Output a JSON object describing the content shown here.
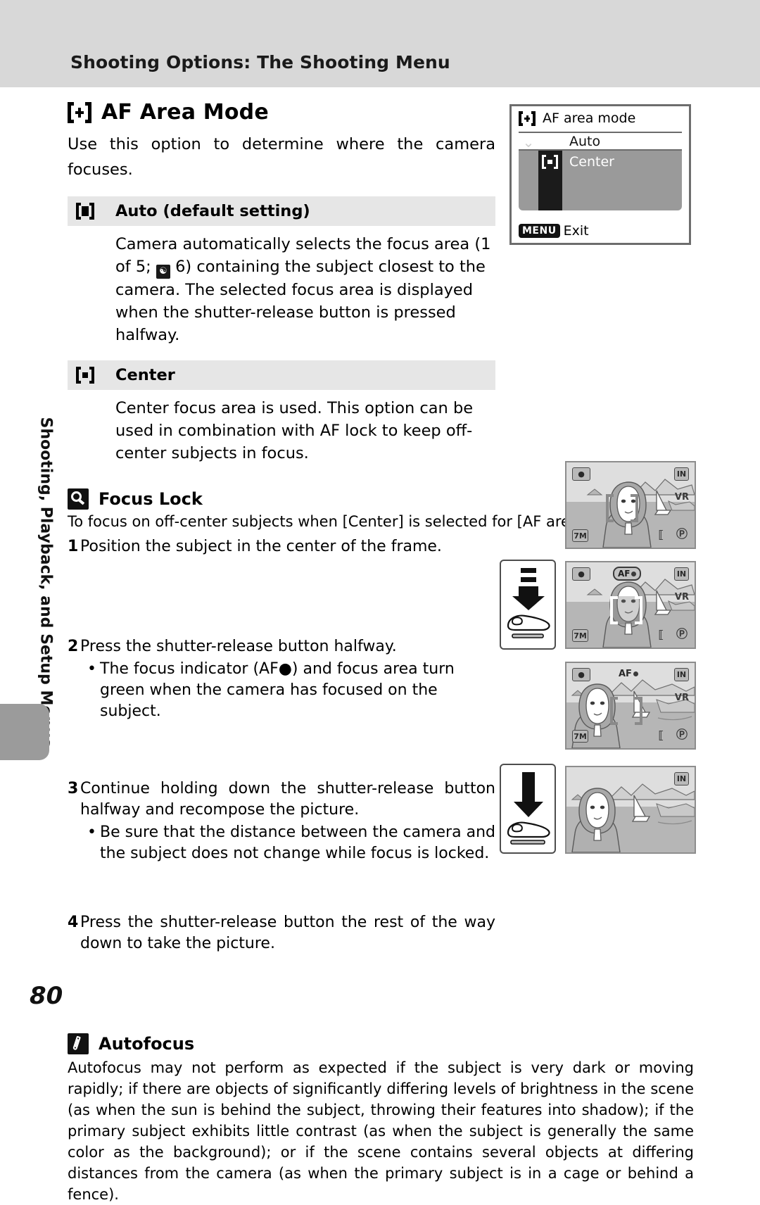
{
  "header": {
    "title": "Shooting Options: The Shooting Menu"
  },
  "side_tab": {
    "label": "Shooting, Playback, and Setup Menus"
  },
  "page_number": "80",
  "section": {
    "icon": "af-area-bracket-plus-icon",
    "title": "AF Area Mode",
    "intro": "Use this option to determine where the camera focuses."
  },
  "options": [
    {
      "icon": "bracket-filled-square-icon",
      "label": "Auto (default setting)",
      "body_before": "Camera automatically selects the focus area (1 of 5;",
      "body_glyph": "6",
      "body_after": ") containing the subject closest to the camera. The selected focus area is displayed when the shutter-release button is pressed halfway."
    },
    {
      "icon": "bracket-small-square-icon",
      "label": "Center",
      "body": "Center focus area is used. This option can be used in combination with AF lock to keep off-center subjects in focus."
    }
  ],
  "focus_lock": {
    "icon": "lightbulb-tip-icon",
    "title": "Focus Lock",
    "intro": "To focus on off-center subjects when [Center] is selected for [AF area mode]:",
    "steps": [
      {
        "num": "1",
        "text": "Position the subject in the center of the frame.",
        "bullets": []
      },
      {
        "num": "2",
        "text": "Press the shutter-release button halfway.",
        "bullets": [
          "The focus indicator (AF●) and focus area turn green when the camera has focused on the subject."
        ]
      },
      {
        "num": "3",
        "text": "Continue holding down the shutter-release button halfway and recompose the picture.",
        "bullets": [
          "Be sure that the distance between the camera and the subject does not change while focus is locked."
        ]
      },
      {
        "num": "4",
        "text": "Press the shutter-release button the rest of the way down to take the picture.",
        "bullets": []
      }
    ]
  },
  "autofocus": {
    "icon": "pencil-note-icon",
    "title": "Autofocus",
    "body": "Autofocus may not perform as expected if the subject is very dark or moving rapidly; if there are objects of significantly differing levels of brightness in the scene (as when the sun is behind the subject, throwing their features into shadow); if the primary subject exhibits little contrast (as when the subject is generally the same color as the background); or if the scene contains several objects at differing distances from the camera (as when the primary subject is in a cage or behind a fence)."
  },
  "lcd_menu": {
    "title": "AF area mode",
    "title_icon": "bracket-plus-icon",
    "items": [
      {
        "label": "Auto",
        "icon": "bracket-filled-square-icon",
        "selected": true
      },
      {
        "label": "Center",
        "icon": "bracket-small-square-icon",
        "selected": false
      }
    ],
    "footer_button": "MENU",
    "footer_label": "Exit"
  },
  "illustrations": [
    {
      "step": "1",
      "lcd_badges": {
        "mode": "camera-mode-icon",
        "memory": "IN",
        "vr": "VR",
        "size": "7M",
        "battery": "battery-icon",
        "flash": "flash-icon"
      },
      "focus_indicator": null,
      "subject_position": "center",
      "press": null
    },
    {
      "step": "2",
      "lcd_badges": {
        "mode": "camera-mode-icon",
        "memory": "IN",
        "vr": "VR",
        "size": "7M",
        "battery": "battery-icon",
        "flash": "flash-icon"
      },
      "focus_indicator": "AF",
      "focus_indicator_highlighted": true,
      "subject_position": "center",
      "press": "halfway"
    },
    {
      "step": "3",
      "lcd_badges": {
        "mode": "camera-mode-icon",
        "memory": "IN",
        "vr": "VR",
        "size": "7M",
        "battery": "battery-icon",
        "flash": "flash-icon"
      },
      "focus_indicator": "AF",
      "focus_indicator_highlighted": false,
      "subject_position": "left",
      "press": null
    },
    {
      "step": "4",
      "lcd_badges": {
        "memory": "IN"
      },
      "focus_indicator": null,
      "subject_position": "left",
      "press": "full"
    }
  ],
  "colors": {
    "header_band": "#d8d8d8",
    "option_row": "#e6e6e6",
    "side_tab": "#9b9b9b",
    "lcd_body": "#9a9a9a",
    "lcd_rail": "#1b1b1b"
  }
}
